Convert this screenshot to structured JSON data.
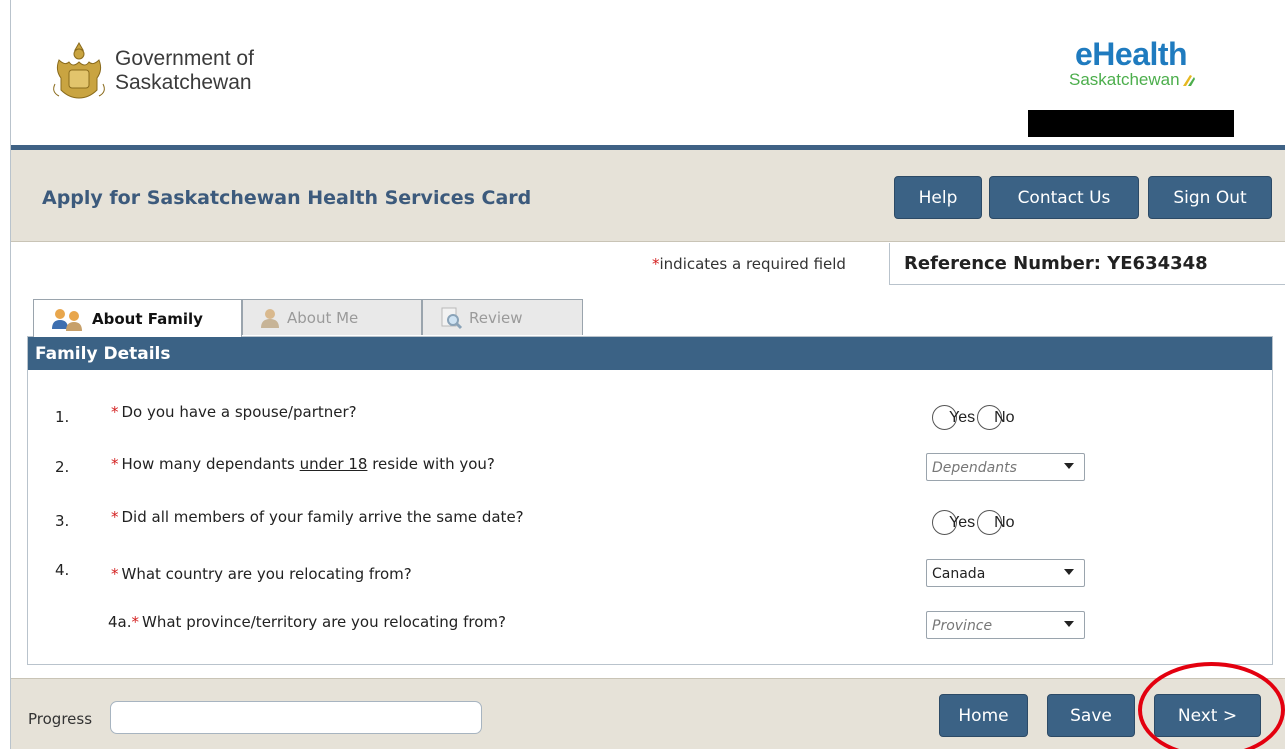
{
  "header": {
    "gov_line1": "Government of",
    "gov_line2": "Saskatchewan",
    "ehealth_main": "eHealth",
    "ehealth_sub": "Saskatchewan"
  },
  "titlebar": {
    "title": "Apply for Saskatchewan Health Services Card",
    "help_label": "Help",
    "contact_label": "Contact Us",
    "signout_label": "Sign Out"
  },
  "required_note": {
    "star": "*",
    "text": "indicates a required field"
  },
  "reference": "Reference Number: YE634348",
  "tabs": [
    {
      "label": "About Family",
      "active": true,
      "icon": "family-icon"
    },
    {
      "label": "About Me",
      "active": false,
      "icon": "person-icon"
    },
    {
      "label": "Review",
      "active": false,
      "icon": "magnifier-document-icon"
    }
  ],
  "section": {
    "title": "Family Details",
    "questions": [
      {
        "num": "1.",
        "star": "*",
        "text": "Do you have a spouse/partner?",
        "type": "radio",
        "options": [
          "Yes",
          "No"
        ]
      },
      {
        "num": "2.",
        "star": "*",
        "text_before": "How many dependants ",
        "text_underlined": "under 18",
        "text_after": " reside with you?",
        "type": "select",
        "value": "Dependants",
        "placeholder": true
      },
      {
        "num": "3.",
        "star": "*",
        "text": "Did all members of your family arrive the same date?",
        "type": "radio",
        "options": [
          "Yes",
          "No"
        ]
      },
      {
        "num": "4.",
        "star": "*",
        "text": "What country are you relocating from?",
        "type": "select",
        "value": "Canada",
        "placeholder": false
      },
      {
        "num": "4a.",
        "star": "*",
        "text": "What province/territory are you relocating from?",
        "type": "select",
        "value": "Province",
        "placeholder": true
      }
    ]
  },
  "footer": {
    "progress_label": "Progress",
    "progress_value": 0,
    "home_label": "Home",
    "save_label": "Save",
    "next_label": "Next >"
  },
  "colors": {
    "brand_blue": "#3b6285",
    "title_text": "#3c5a7c",
    "band": "#e6e2d8",
    "required_star": "#d32020",
    "highlight_circle": "#e3000f"
  }
}
